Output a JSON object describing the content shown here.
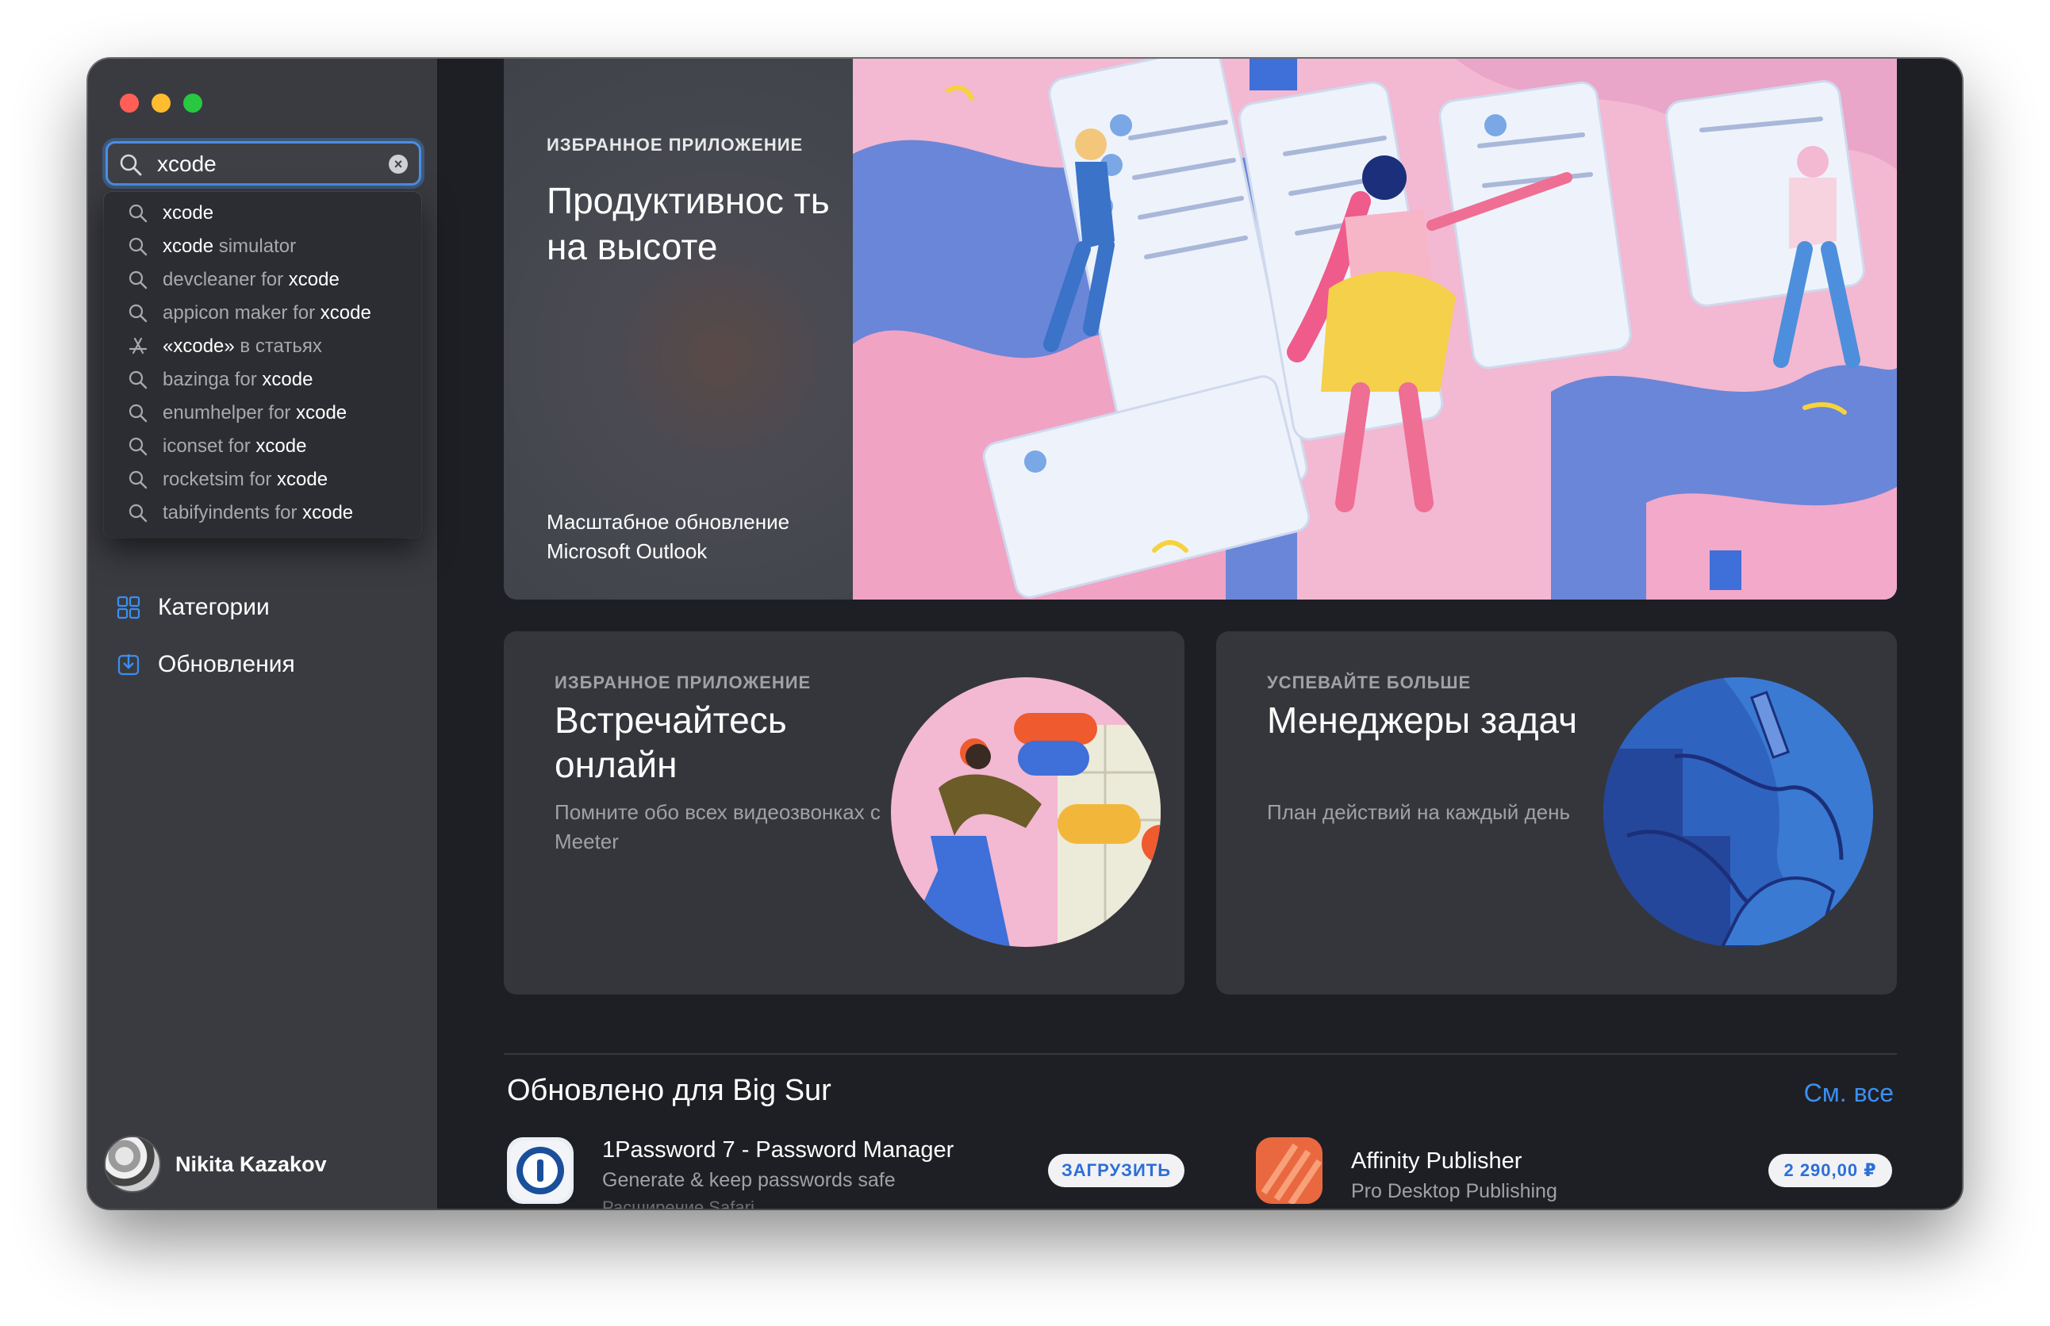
{
  "search": {
    "value": "xcode"
  },
  "suggestions": [
    {
      "icon": "search-icon",
      "bold": "xcode",
      "rest": "",
      "order": "bold-first"
    },
    {
      "icon": "search-icon",
      "bold": "xcode",
      "rest": " simulator",
      "order": "bold-first"
    },
    {
      "icon": "search-icon",
      "bold": "xcode",
      "rest": "devcleaner for ",
      "order": "rest-first"
    },
    {
      "icon": "search-icon",
      "bold": "xcode",
      "rest": "appicon maker for ",
      "order": "rest-first"
    },
    {
      "icon": "app-store-icon",
      "bold": "«xcode»",
      "rest": " в статьях",
      "order": "bold-first"
    },
    {
      "icon": "search-icon",
      "bold": "xcode",
      "rest": "bazinga for ",
      "order": "rest-first"
    },
    {
      "icon": "search-icon",
      "bold": "xcode",
      "rest": "enumhelper for ",
      "order": "rest-first"
    },
    {
      "icon": "search-icon",
      "bold": "xcode",
      "rest": "iconset for ",
      "order": "rest-first"
    },
    {
      "icon": "search-icon",
      "bold": "xcode",
      "rest": "rocketsim for ",
      "order": "rest-first"
    },
    {
      "icon": "search-icon",
      "bold": "xcode",
      "rest": "tabifyindents for ",
      "order": "rest-first"
    }
  ],
  "sidebar": {
    "items": [
      {
        "label": "Категории",
        "icon": "categories-icon"
      },
      {
        "label": "Обновления",
        "icon": "updates-icon"
      }
    ],
    "user": {
      "name": "Nikita Kazakov"
    }
  },
  "hero": {
    "eyebrow": "ИЗБРАННОЕ ПРИЛОЖЕНИЕ",
    "title": "Продуктивнос ть на высоте",
    "subtitle": "Масштабное обновление Microsoft Outlook"
  },
  "cards": [
    {
      "eyebrow": "ИЗБРАННОЕ ПРИЛОЖЕНИЕ",
      "title": "Встречайтесь онлайн",
      "subtitle": "Помните обо всех видеозвонках с Meeter"
    },
    {
      "eyebrow": "УСПЕВАЙТЕ БОЛЬШЕ",
      "title": "Менеджеры задач",
      "subtitle": "План действий на каждый день"
    }
  ],
  "section": {
    "title": "Обновлено для Big Sur",
    "see_all": "См. все"
  },
  "apps": [
    {
      "name": "1Password 7 - Password Manager",
      "desc": "Generate & keep passwords safe",
      "desc2": "Расширение Safari",
      "button": "ЗАГРУЗИТЬ"
    },
    {
      "name": "Affinity Publisher",
      "desc": "Pro Desktop Publishing",
      "button": "2 290,00 ₽"
    }
  ],
  "colors": {
    "accent": "#3b8ff0",
    "sidebar": "#3a3b41",
    "background": "#1e1f24"
  }
}
